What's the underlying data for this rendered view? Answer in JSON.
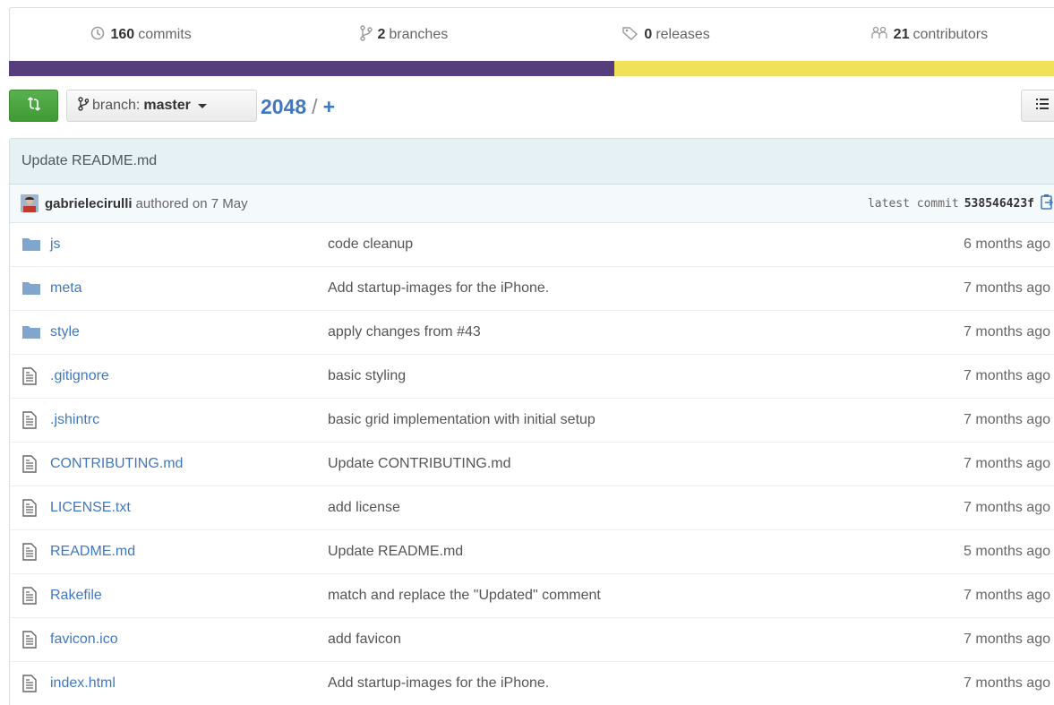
{
  "stats": {
    "commits": {
      "num": "160",
      "label": "commits"
    },
    "branches": {
      "num": "2",
      "label": "branches"
    },
    "releases": {
      "num": "0",
      "label": "releases"
    },
    "contributors": {
      "num": "21",
      "label": "contributors"
    }
  },
  "languages": [
    {
      "color": "#563d7c",
      "share": 0.575
    },
    {
      "color": "#f1e05a",
      "share": 0.425
    }
  ],
  "toolbar": {
    "branch_label": "branch:",
    "branch_name": "master",
    "repo": "2048",
    "separator": "/",
    "plus": "+"
  },
  "commit": {
    "title": "Update README.md",
    "author": "gabrielecirulli",
    "authored": "authored on 7 May",
    "latest_label": "latest commit",
    "sha": "538546423f"
  },
  "files": [
    {
      "type": "folder",
      "name": "js",
      "message": "code cleanup",
      "age": "6 months ago"
    },
    {
      "type": "folder",
      "name": "meta",
      "message": "Add startup-images for the iPhone.",
      "age": "7 months ago"
    },
    {
      "type": "folder",
      "name": "style",
      "message": "apply changes from #43",
      "age": "7 months ago"
    },
    {
      "type": "file",
      "name": ".gitignore",
      "message": "basic styling",
      "age": "7 months ago"
    },
    {
      "type": "file",
      "name": ".jshintrc",
      "message": "basic grid implementation with initial setup",
      "age": "7 months ago"
    },
    {
      "type": "file",
      "name": "CONTRIBUTING.md",
      "message": "Update CONTRIBUTING.md",
      "age": "7 months ago"
    },
    {
      "type": "file",
      "name": "LICENSE.txt",
      "message": "add license",
      "age": "7 months ago"
    },
    {
      "type": "file",
      "name": "README.md",
      "message": "Update README.md",
      "age": "5 months ago"
    },
    {
      "type": "file",
      "name": "Rakefile",
      "message": "match and replace the \"Updated\" comment",
      "age": "7 months ago"
    },
    {
      "type": "file",
      "name": "favicon.ico",
      "message": "add favicon",
      "age": "7 months ago"
    },
    {
      "type": "file",
      "name": "index.html",
      "message": "Add startup-images for the iPhone.",
      "age": "7 months ago"
    }
  ]
}
